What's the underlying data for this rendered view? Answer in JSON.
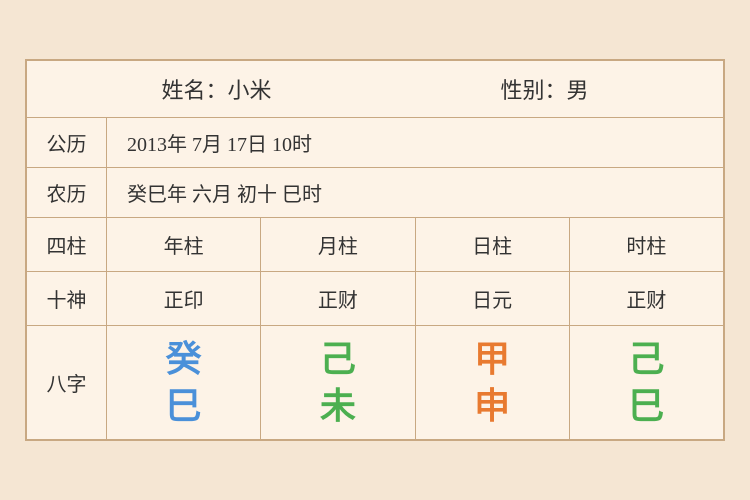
{
  "header": {
    "name_label": "姓名：小米",
    "gender_label": "性别：男"
  },
  "rows": {
    "gregorian_label": "公历",
    "gregorian_value": "2013年 7月 17日 10时",
    "lunar_label": "农历",
    "lunar_value": "癸巳年 六月 初十 巳时"
  },
  "table": {
    "col1_label": "四柱",
    "col2_label": "十神",
    "col3_label": "八字",
    "headers": [
      "年柱",
      "月柱",
      "日柱",
      "时柱"
    ],
    "shishen": [
      "正印",
      "正财",
      "日元",
      "正财"
    ],
    "bazi_top": [
      "癸",
      "己",
      "甲",
      "己"
    ],
    "bazi_bottom": [
      "巳",
      "未",
      "申",
      "巳"
    ],
    "bazi_top_colors": [
      "blue",
      "green",
      "orange",
      "green"
    ],
    "bazi_bottom_colors": [
      "blue",
      "green",
      "orange",
      "green"
    ]
  }
}
